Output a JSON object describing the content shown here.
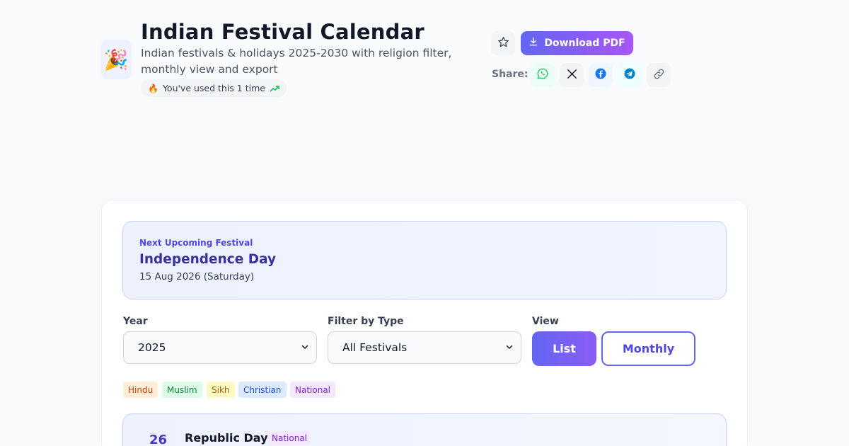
{
  "header": {
    "app_icon": "🎉",
    "title": "Indian Festival Calendar",
    "subtitle": "Indian festivals & holidays 2025-2030 with religion filter, monthly view and export",
    "usage": {
      "emoji": "🔥",
      "text": "You've used this 1 time",
      "trend_icon": "trending-up-icon"
    }
  },
  "actions": {
    "favorite_icon": "star-icon",
    "download_label": "Download PDF",
    "download_icon": "download-icon"
  },
  "share": {
    "label": "Share:",
    "buttons": [
      {
        "name": "whatsapp",
        "icon": "whatsapp-icon",
        "bg": "#ecfdf5",
        "color": "#22c55e"
      },
      {
        "name": "x",
        "icon": "x-icon",
        "bg": "#f3f4f6",
        "color": "#111827"
      },
      {
        "name": "facebook",
        "icon": "facebook-icon",
        "bg": "#eff6ff",
        "color": "#1877f2"
      },
      {
        "name": "telegram",
        "icon": "telegram-icon",
        "bg": "#ecfeff",
        "color": "#0284c7"
      },
      {
        "name": "copy-link",
        "icon": "link-icon",
        "bg": "#f3f4f6",
        "color": "#6b7280"
      }
    ]
  },
  "upcoming": {
    "eyebrow": "Next Upcoming Festival",
    "name": "Independence Day",
    "date": "15 Aug 2026 (Saturday)"
  },
  "filters": {
    "year_label": "Year",
    "year_value": "2025",
    "type_label": "Filter by Type",
    "type_value": "All Festivals",
    "view_label": "View",
    "view_options": [
      "List",
      "Monthly"
    ],
    "view_selected": "List"
  },
  "legend": [
    {
      "label": "Hindu",
      "bg": "#ffedd5",
      "color": "#c2410c"
    },
    {
      "label": "Muslim",
      "bg": "#dcfce7",
      "color": "#15803d"
    },
    {
      "label": "Sikh",
      "bg": "#fef9c3",
      "color": "#a16207"
    },
    {
      "label": "Christian",
      "bg": "#dbeafe",
      "color": "#1d4ed8"
    },
    {
      "label": "National",
      "bg": "#f3e8ff",
      "color": "#7e22ce"
    }
  ],
  "festivals": [
    {
      "day": "26",
      "name": "Republic Day",
      "type": "National"
    }
  ],
  "colors": {
    "accent": "#6366f1",
    "accent_end": "#a855f7",
    "upcoming_text": "#3730a3"
  }
}
